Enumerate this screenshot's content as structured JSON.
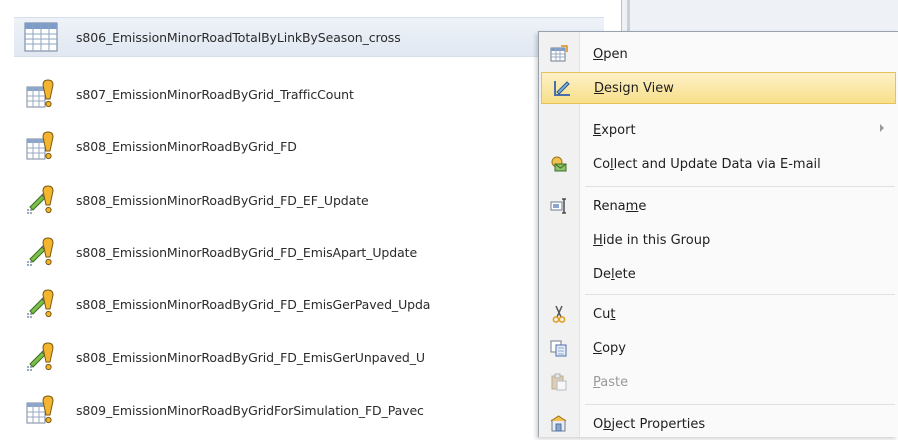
{
  "objects": [
    {
      "label": "s806_EmissionMinorRoadTotalByLinkBySeason_cross",
      "icon": "table-query-icon",
      "selected": true
    },
    {
      "label": "s807_EmissionMinorRoadByGrid_TrafficCount",
      "icon": "make-table-query-icon"
    },
    {
      "label": "s808_EmissionMinorRoadByGrid_FD",
      "icon": "make-table-query-icon"
    },
    {
      "label": "s808_EmissionMinorRoadByGrid_FD_EF_Update",
      "icon": "update-query-icon"
    },
    {
      "label": "s808_EmissionMinorRoadByGrid_FD_EmisApart_Update",
      "icon": "update-query-icon"
    },
    {
      "label": "s808_EmissionMinorRoadByGrid_FD_EmisGerPaved_Upda",
      "icon": "update-query-icon"
    },
    {
      "label": "s808_EmissionMinorRoadByGrid_FD_EmisGerUnpaved_U",
      "icon": "update-query-icon"
    },
    {
      "label": "s809_EmissionMinorRoadByGridForSimulation_FD_Pavec",
      "icon": "make-table-query-icon"
    }
  ],
  "context_menu": {
    "items": [
      {
        "pre": "",
        "ul": "O",
        "post": "pen",
        "icon": "open-icon"
      },
      {
        "pre": "",
        "ul": "D",
        "post": "esign View",
        "icon": "design-view-icon",
        "highlighted": true
      },
      {
        "pre": "",
        "ul": "E",
        "post": "xport",
        "icon": "",
        "submenu": true
      },
      {
        "pre": "Co",
        "ul": "l",
        "post": "lect and Update Data via E-mail",
        "icon": "collect-data-icon"
      },
      {
        "pre": "Rena",
        "ul": "m",
        "post": "e",
        "icon": "rename-icon"
      },
      {
        "pre": "",
        "ul": "H",
        "post": "ide in this Group",
        "icon": ""
      },
      {
        "pre": "De",
        "ul": "l",
        "post": "ete",
        "icon": ""
      },
      {
        "pre": "Cu",
        "ul": "t",
        "post": "",
        "icon": "scissors-icon"
      },
      {
        "pre": "",
        "ul": "C",
        "post": "opy",
        "icon": "copy-icon"
      },
      {
        "pre": "",
        "ul": "P",
        "post": "aste",
        "icon": "paste-icon",
        "disabled": true
      },
      {
        "pre": "O",
        "ul": "b",
        "post": "ject Properties",
        "icon": "properties-icon"
      }
    ]
  },
  "colors": {
    "highlight": "#f8df8a",
    "selected_row": "#e1e8f2"
  }
}
